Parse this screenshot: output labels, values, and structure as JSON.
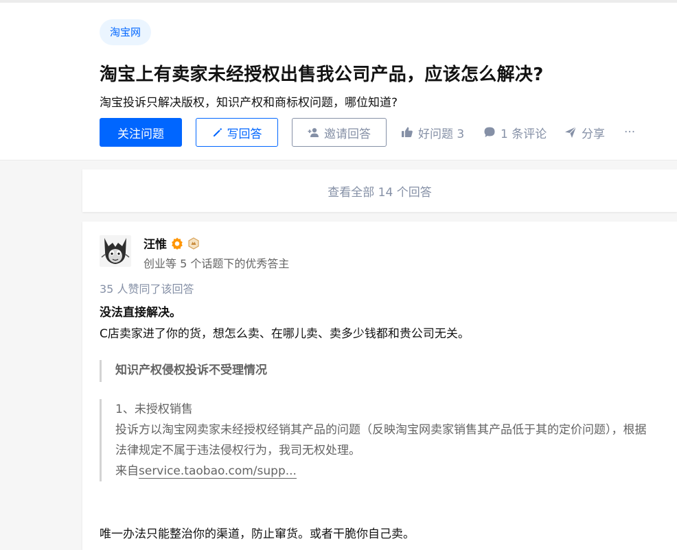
{
  "question": {
    "topic_tag": "淘宝网",
    "title": "淘宝上有卖家未经授权出售我公司产品，应该怎么解决?",
    "description": "淘宝投诉只解决版权，知识产权和商标权问题，哪位知道?"
  },
  "actions": {
    "follow_label": "关注问题",
    "write_label": "写回答",
    "invite_label": "邀请回答",
    "good_question_label": "好问题 3",
    "comment_label": "1 条评论",
    "share_label": "分享",
    "more_label": "···"
  },
  "view_all": "查看全部 14 个回答",
  "answer": {
    "author_name": "汪惟",
    "author_headline": "创业等 5 个话题下的优秀答主",
    "voters": "35 人赞同了该回答",
    "strong_text": "没法直接解决。",
    "line1": "C店卖家进了你的货，想怎么卖、在哪儿卖、卖多少钱都和贵公司无关。",
    "quote_heading": "知识产权侵权投诉不受理情况",
    "quote_item_title": "1、未授权销售",
    "quote_item_body": "投诉方以淘宝网卖家未经授权经销其产品的问题（反映淘宝网卖家销售其产品低于其的定价问题），根据法律规定不属于违法侵权行为，我司无权处理。",
    "quote_source_prefix": "来自",
    "quote_source_link": "service.taobao.com/supp...",
    "last_line": "唯一办法只能整治你的渠道，防止窜货。或者干脆你自己卖。"
  },
  "icons": {
    "write": "pencil-icon",
    "invite": "add-user-icon",
    "good_question": "thumbs-up-icon",
    "comment": "comment-bubble-icon",
    "share": "paper-plane-icon",
    "author_badge_1": "orange-gear-badge-icon",
    "author_badge_2": "gold-hexagon-badge-icon"
  },
  "colors": {
    "brand_blue": "#0066ff",
    "muted_gray": "#8590a6",
    "text_dark": "#121212",
    "tag_bg": "#ebf5ff"
  }
}
